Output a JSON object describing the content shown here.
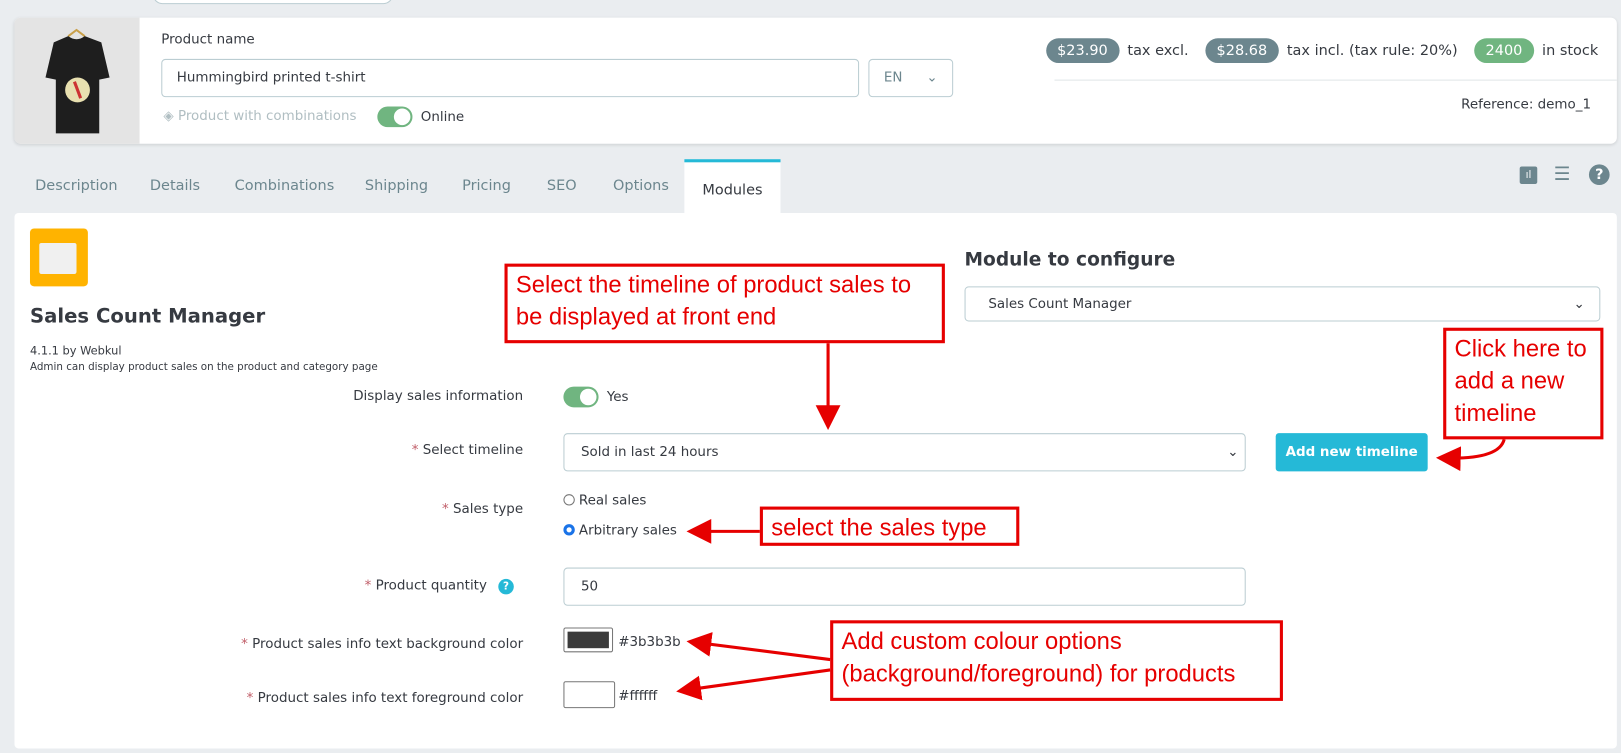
{
  "header": {
    "product_name_label": "Product name",
    "product_name_value": "Hummingbird printed t-shirt",
    "language": "EN",
    "combinations_label": "Product with combinations",
    "online_label": "Online",
    "price_excl": "$23.90",
    "price_excl_label": "tax excl.",
    "price_incl": "$28.68",
    "price_incl_label": "tax incl. (tax rule: 20%)",
    "stock": "2400",
    "stock_label": "in stock",
    "reference": "Reference: demo_1"
  },
  "tabs": [
    {
      "label": "Description"
    },
    {
      "label": "Details"
    },
    {
      "label": "Combinations"
    },
    {
      "label": "Shipping"
    },
    {
      "label": "Pricing"
    },
    {
      "label": "SEO"
    },
    {
      "label": "Options"
    },
    {
      "label": "Modules",
      "active": true
    }
  ],
  "module": {
    "name": "Sales Count Manager",
    "version": "4.1.1 by Webkul",
    "description": "Admin can display product sales on the product and category page",
    "configure_label": "Module to configure",
    "configure_value": "Sales Count Manager"
  },
  "form": {
    "display_label": "Display sales information",
    "display_value": "Yes",
    "timeline_label": "Select timeline",
    "timeline_value": "Sold in last 24 hours",
    "add_timeline": "Add new timeline",
    "sales_type_label": "Sales type",
    "sales_types": [
      "Real sales",
      "Arbitrary sales"
    ],
    "quantity_label": "Product quantity",
    "quantity_value": "50",
    "bg_label": "Product sales info text background color",
    "bg_value": "#3b3b3b",
    "fg_label": "Product sales info text foreground color",
    "fg_value": "#ffffff",
    "required_mark": "*"
  },
  "annotations": {
    "timeline": "Select the timeline of product sales to be displayed at front end",
    "add": "Click here to add a new timeline",
    "sales_type": "select the sales type",
    "colors": "Add custom colour options (background/foreground) for products"
  },
  "colors": {
    "accent": "#25b9d7",
    "badge_grey": "#6c868e",
    "badge_green": "#70b580",
    "annotation": "#e60000"
  }
}
